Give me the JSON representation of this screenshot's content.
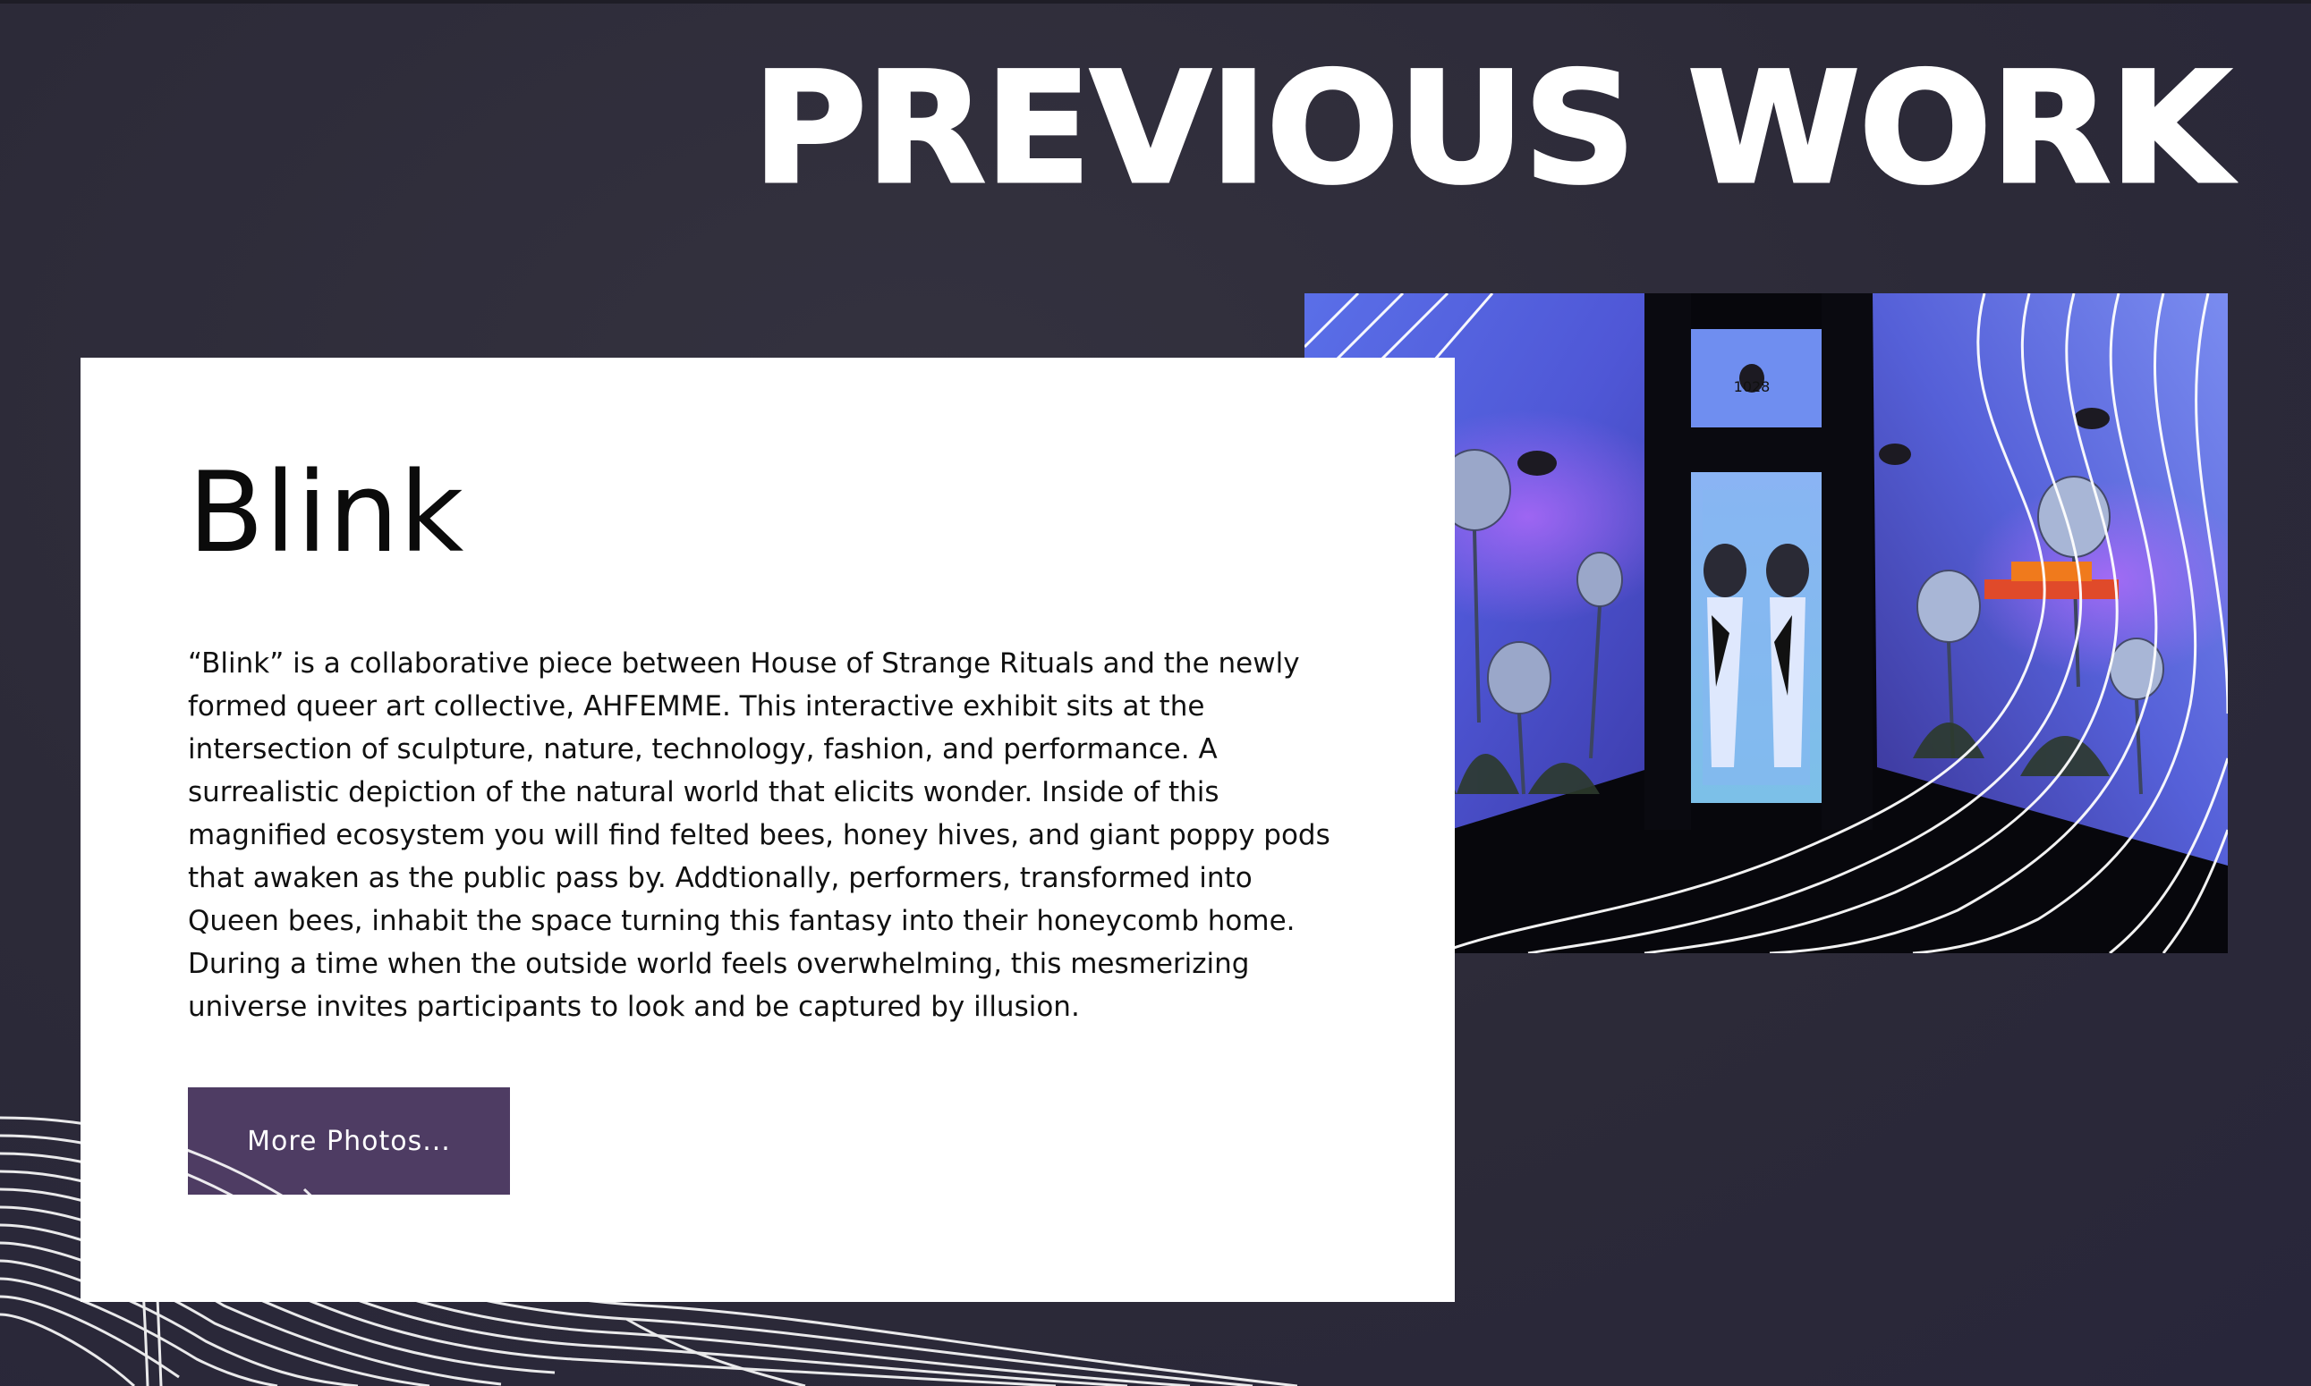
{
  "section": {
    "heading": "PREVIOUS WORK"
  },
  "project": {
    "title": "Blink",
    "description": "“Blink” is a collaborative piece between House of Strange Rituals and the newly formed queer art collective, AHFEMME. This interactive exhibit sits at the intersection of sculpture, nature, technology, fashion, and performance. A surrealistic depiction of the natural world that elicits wonder. Inside of this magnified ecosystem you will find felted bees, honey hives, and giant poppy pods that awaken as the public pass by. Addtionally, performers, transformed into Queen bees, inhabit the space turning this fantasy into their honeycomb home. During a time when the outside world feels overwhelming, this mesmerizing universe invites participants to look and be captured by illusion.",
    "more_button": "More Photos...",
    "photo_number_label": "1028",
    "photo_icon": "exhibit-photo-image"
  },
  "colors": {
    "background": "#2d2b3a",
    "card": "#ffffff",
    "button": "#4e3c63",
    "heading": "#ffffff"
  }
}
